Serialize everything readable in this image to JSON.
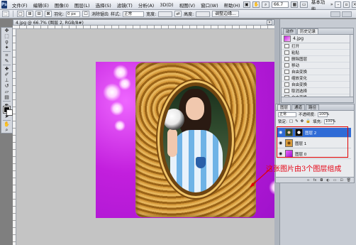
{
  "app": {
    "logo_text": "Ps",
    "menu": [
      "文件(F)",
      "编辑(E)",
      "图像(I)",
      "图层(L)",
      "选择(S)",
      "滤镜(T)",
      "分析(A)",
      "3D(D)",
      "视图(V)",
      "窗口(W)",
      "帮助(H)"
    ],
    "zoom_value": "66.7",
    "workspace": "基本功能"
  },
  "options_bar": {
    "feather_label": "羽化:",
    "feather_value": "0 px",
    "antialias_label": "消除锯齿",
    "style_label": "样式:",
    "style_value": "正常",
    "width_label": "宽度:",
    "height_label": "高度:",
    "refine_edge_button": "调整边缘..."
  },
  "document": {
    "tab_title": "4.jpg @ 66.7% (图层 2, RGB/8#)"
  },
  "history_panel": {
    "tabs": [
      "动作",
      "历史记录"
    ],
    "snapshot_label": "4.jpg",
    "items": [
      "打开",
      "粘贴",
      "删除图层",
      "移动",
      "自由变换",
      "缩放变化",
      "自由变换",
      "取消选择",
      "自由变换",
      "移动"
    ]
  },
  "layers_panel": {
    "tabs": [
      "图层",
      "通道",
      "路径"
    ],
    "blend_mode": "正常",
    "opacity_label": "不透明度:",
    "opacity_value": "100%",
    "lock_label": "锁定:",
    "fill_label": "填充:",
    "fill_value": "100%",
    "layers": [
      {
        "name": "图层 2",
        "selected": true
      },
      {
        "name": "图层 1",
        "selected": false
      },
      {
        "name": "图层 0",
        "selected": false
      }
    ],
    "bottom_icons": [
      "link",
      "fx",
      "mask",
      "adjust",
      "folder",
      "new",
      "delete"
    ]
  },
  "annotation": {
    "text": "这张图片由3个图层组成",
    "color": "#e60012"
  },
  "colors": {
    "accent": "#2f6bd6",
    "canvas_bg": "#c21fdd"
  }
}
